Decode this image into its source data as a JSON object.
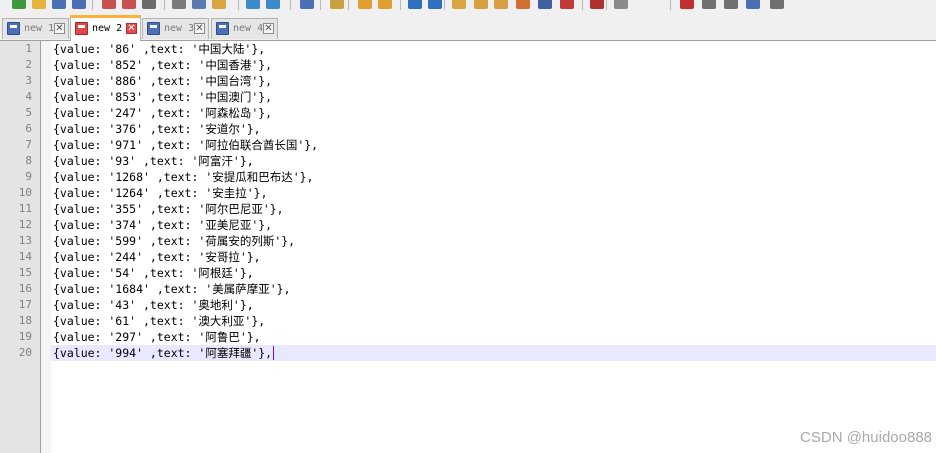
{
  "tabs": [
    {
      "label": "new 1",
      "close": "✕",
      "active": false,
      "state": "saved"
    },
    {
      "label": "new 2",
      "close": "✕",
      "active": true,
      "state": "unsaved"
    },
    {
      "label": "new 3",
      "close": "✕",
      "active": false,
      "state": "saved"
    },
    {
      "label": "new 4",
      "close": "✕",
      "active": false,
      "state": "saved"
    }
  ],
  "editor": {
    "current_line": 20,
    "lines": [
      {
        "num": "1",
        "text": "{value: '86' ,text: '中国大陆'},"
      },
      {
        "num": "2",
        "text": "{value: '852' ,text: '中国香港'},"
      },
      {
        "num": "3",
        "text": "{value: '886' ,text: '中国台湾'},"
      },
      {
        "num": "4",
        "text": "{value: '853' ,text: '中国澳门'},"
      },
      {
        "num": "5",
        "text": "{value: '247' ,text: '阿森松岛'},"
      },
      {
        "num": "6",
        "text": "{value: '376' ,text: '安道尔'},"
      },
      {
        "num": "7",
        "text": "{value: '971' ,text: '阿拉伯联合酋长国'},"
      },
      {
        "num": "8",
        "text": "{value: '93' ,text: '阿富汗'},"
      },
      {
        "num": "9",
        "text": "{value: '1268' ,text: '安提瓜和巴布达'},"
      },
      {
        "num": "10",
        "text": "{value: '1264' ,text: '安圭拉'},"
      },
      {
        "num": "11",
        "text": "{value: '355' ,text: '阿尔巴尼亚'},"
      },
      {
        "num": "12",
        "text": "{value: '374' ,text: '亚美尼亚'},"
      },
      {
        "num": "13",
        "text": "{value: '599' ,text: '荷属安的列斯'},"
      },
      {
        "num": "14",
        "text": "{value: '244' ,text: '安哥拉'},"
      },
      {
        "num": "15",
        "text": "{value: '54' ,text: '阿根廷'},"
      },
      {
        "num": "16",
        "text": "{value: '1684' ,text: '美属萨摩亚'},"
      },
      {
        "num": "17",
        "text": "{value: '43' ,text: '奥地利'},"
      },
      {
        "num": "18",
        "text": "{value: '61' ,text: '澳大利亚'},"
      },
      {
        "num": "19",
        "text": "{value: '297' ,text: '阿鲁巴'},"
      },
      {
        "num": "20",
        "text": "{value: '994' ,text: '阿塞拜疆'},"
      }
    ]
  },
  "watermark": "CSDN @huidoo888",
  "colors": {
    "active_tab_accent": "#ffb03a",
    "current_line_highlight": "#e8e8ff",
    "caret": "#8000ff"
  },
  "toolbar_icons": [
    "new-file-icon",
    "open-file-icon",
    "save-icon",
    "save-all-icon",
    "close-icon",
    "close-all-icon",
    "print-icon",
    "cut-icon",
    "copy-icon",
    "paste-icon",
    "undo-icon",
    "redo-icon",
    "find-icon",
    "replace-icon",
    "zoom-in-icon",
    "zoom-out-icon",
    "sync-vertical-icon",
    "sync-horizontal-icon",
    "word-wrap-icon",
    "show-all-chars-icon",
    "indent-guide-icon",
    "user-lang-icon",
    "doc-map-icon",
    "function-list-icon",
    "folder-workspace-icon",
    "monitoring-icon",
    "record-macro-icon",
    "stop-macro-icon",
    "play-macro-icon",
    "run-macro-multiple-icon",
    "save-macro-icon"
  ]
}
